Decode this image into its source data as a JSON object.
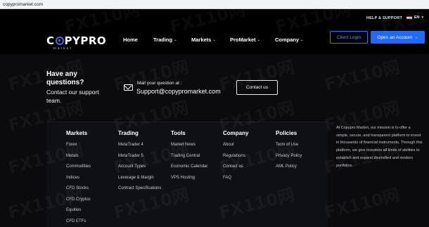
{
  "browser": {
    "url": "copypromarket.com"
  },
  "topbar": {
    "help_label": "HELP & SUPPORT",
    "language": "EN"
  },
  "brand": {
    "name_part1": "C",
    "name_part2": "PYPRO",
    "sub": "market"
  },
  "nav": {
    "items": [
      {
        "label": "Home",
        "has_caret": false
      },
      {
        "label": "Trading",
        "has_caret": true
      },
      {
        "label": "Markets",
        "has_caret": true
      },
      {
        "label": "ProMarket",
        "has_caret": true
      },
      {
        "label": "Company",
        "has_caret": true
      }
    ],
    "client_login": "Client Login",
    "open_account": "Open an Account →"
  },
  "contact": {
    "title": "Have any questions?",
    "subtitle": "Contact our support team.",
    "mail_label": "Mail your question at :",
    "email": "Support@copypromarket.com",
    "button": "Contact us"
  },
  "footer": {
    "columns": [
      {
        "heading": "Markets",
        "items": [
          "Forex",
          "Metals",
          "Commodities",
          "Indices",
          "CFD Stocks",
          "CFD Cryptos",
          "Equities",
          "CFD ETFs"
        ]
      },
      {
        "heading": "Trading",
        "items": [
          "MetaTrader 4",
          "MetaTrader 5",
          "Account Types",
          "Leverage & Margin",
          "Contract Specifications"
        ]
      },
      {
        "heading": "Tools",
        "items": [
          "Market News",
          "Trading Central",
          "Economic Calendar",
          "VPS Hosting"
        ]
      },
      {
        "heading": "Company",
        "items": [
          "About",
          "Regulations",
          "Contact us",
          "FAQ"
        ]
      },
      {
        "heading": "Policies",
        "items": [
          "Term of Use",
          "Privacy Policy",
          "AML Policy"
        ]
      }
    ],
    "about_text": "At Copypro Market, our mission is to offer a simple, secure, and transparent platform to invest in thousands of financial instruments. Through this platform, we give investors all kinds of abilities to establish and expand diversified and modern portfolios."
  },
  "watermark": "FX110网",
  "colors": {
    "accent": "#1f6bff",
    "background": "#0b0b0d",
    "panel": "#0f1016"
  }
}
